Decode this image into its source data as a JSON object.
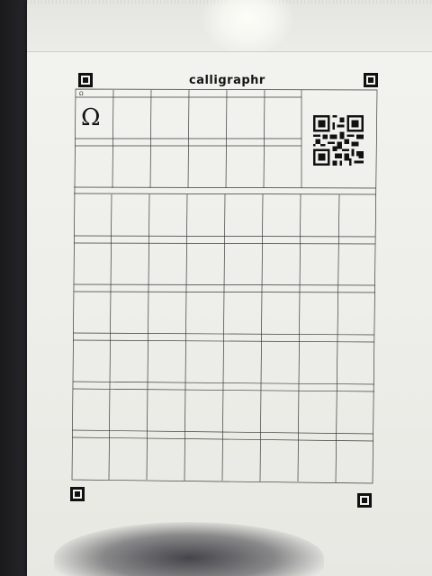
{
  "sheet": {
    "brand_title": "calligraphr",
    "cell_caption": "Ω",
    "sample_glyph": "Ω",
    "qr_icon": "qr-code-icon",
    "registration_icon": "registration-mark-icon"
  },
  "colors": {
    "paper": "#f0f0ec",
    "ink": "#141414",
    "background": "#1b1b1d"
  }
}
